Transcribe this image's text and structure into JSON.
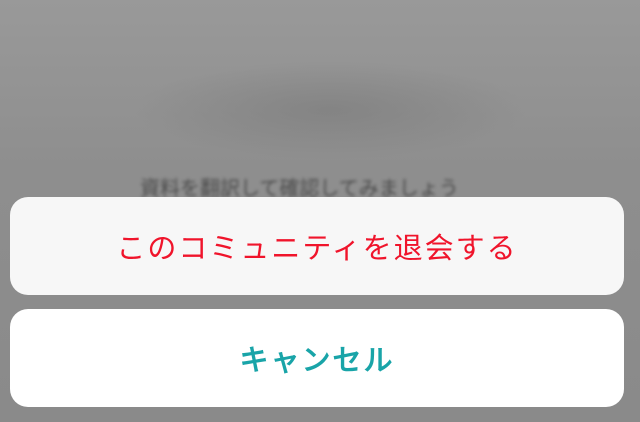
{
  "background": {
    "obscured_text": "資料を翻訳して確認してみましょう"
  },
  "action_sheet": {
    "leave_label": "このコミュニティを退会する",
    "cancel_label": "キャンセル"
  },
  "colors": {
    "destructive": "#f0142b",
    "cancel": "#19a4a8",
    "dim_overlay": "#8f8f8f"
  }
}
